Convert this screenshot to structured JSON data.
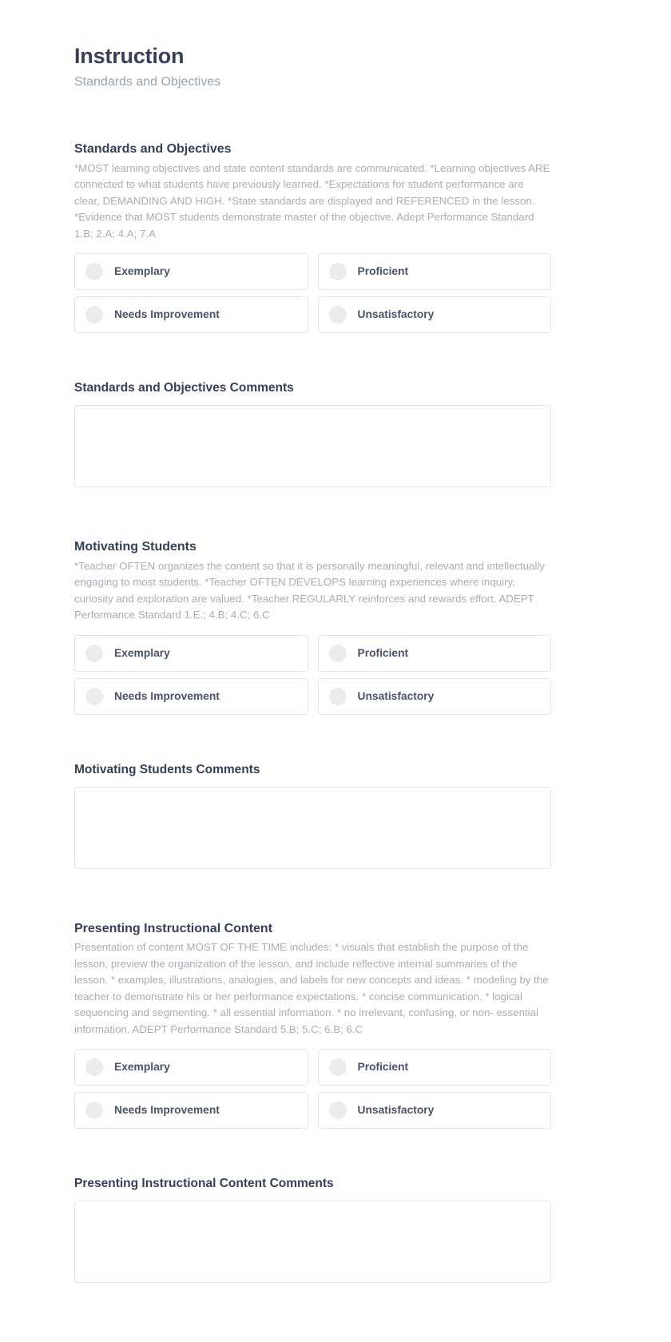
{
  "header": {
    "title": "Instruction",
    "subtitle": "Standards and Objectives"
  },
  "option_labels": {
    "exemplary": "Exemplary",
    "proficient": "Proficient",
    "needs_improvement": "Needs Improvement",
    "unsatisfactory": "Unsatisfactory"
  },
  "colors": {
    "heading": "#36405a",
    "body_text": "#a9adb8",
    "border": "#e3e5e9",
    "radio_fill": "#ececef",
    "background": "#ffffff"
  },
  "sections": [
    {
      "title": "Standards and Objectives",
      "description": "*MOST learning objectives and state content standards are communicated. *Learning objectives ARE connected to what students have previously learned. *Expectations for student performance are clear, DEMANDING AND HIGH. *State standards are displayed and REFERENCED in the lesson. *Evidence that MOST students demonstrate master of the objective. Adept Performance Standard 1.B; 2.A; 4.A; 7.A",
      "options": [
        "Exemplary",
        "Proficient",
        "Needs Improvement",
        "Unsatisfactory"
      ],
      "selected": null,
      "comments_title": "Standards and Objectives Comments",
      "comments_value": "",
      "comments_placeholder": ""
    },
    {
      "title": "Motivating Students",
      "description": "*Teacher OFTEN organizes the content so that it is personally meaningful, relevant and intellectually engaging to most students. *Teacher OFTEN DEVELOPS learning experiences where inquiry, curiosity and exploration are valued. *Teacher REGULARLY reinforces and rewards effort. ADEPT Performance Standard 1.E.; 4.B; 4.C; 6.C",
      "options": [
        "Exemplary",
        "Proficient",
        "Needs Improvement",
        "Unsatisfactory"
      ],
      "selected": null,
      "comments_title": "Motivating Students Comments",
      "comments_value": "",
      "comments_placeholder": ""
    },
    {
      "title": "Presenting Instructional Content",
      "description": "Presentation of content MOST OF THE TIME includes: * visuals that establish the purpose of the lesson, preview the organization of the lesson, and include reflective internal summaries of the lesson. * examples, illustrations, analogies, and labels for new concepts and ideas. * modeling by the teacher to demonstrate his or her performance expectations. * concise communication. * logical sequencing and segmenting. * all essential information. * no irrelevant, confusing, or non- essential information. ADEPT Performance Standard 5.B; 5.C; 6.B; 6.C",
      "options": [
        "Exemplary",
        "Proficient",
        "Needs Improvement",
        "Unsatisfactory"
      ],
      "selected": null,
      "comments_title": "Presenting Instructional Content Comments",
      "comments_value": "",
      "comments_placeholder": ""
    }
  ]
}
